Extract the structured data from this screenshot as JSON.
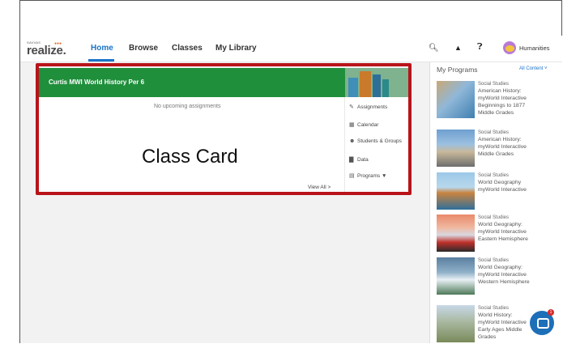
{
  "nav": {
    "logo_small": "SAVVAS",
    "logo_main": "realize.",
    "links": [
      "Home",
      "Browse",
      "Classes",
      "My Library"
    ],
    "user": "Humanities"
  },
  "card": {
    "title": "Curtis MWI World History Per 6",
    "empty_text": "No upcoming assignments",
    "overlay_label": "Class Card",
    "view_all": "View All >",
    "side_items": [
      "Assignments",
      "Calendar",
      "Students & Groups",
      "Data",
      "Programs"
    ]
  },
  "programs": {
    "title": "My Programs",
    "all_link": "All Content ˅",
    "items": [
      {
        "subject": "Social Studies",
        "lines": [
          "American History:",
          "myWorld Interactive",
          "Beginnings to 1877",
          "Middle Grades"
        ]
      },
      {
        "subject": "Social Studies",
        "lines": [
          "American History:",
          "myWorld Interactive",
          "Middle Grades"
        ]
      },
      {
        "subject": "Social Studies",
        "lines": [
          "World Geography",
          "myWorld Interactive"
        ]
      },
      {
        "subject": "Social Studies",
        "lines": [
          "World Geography:",
          "myWorld Interactive",
          "Eastern Hemisphere"
        ]
      },
      {
        "subject": "Social Studies",
        "lines": [
          "World Geography:",
          "myWorld Interactive",
          "Western Hemisphere"
        ]
      },
      {
        "subject": "Social Studies",
        "lines": [
          "World History:",
          "myWorld Interactive",
          "Early Ages Middle",
          "Grades"
        ]
      }
    ]
  },
  "chat_badge": "1"
}
